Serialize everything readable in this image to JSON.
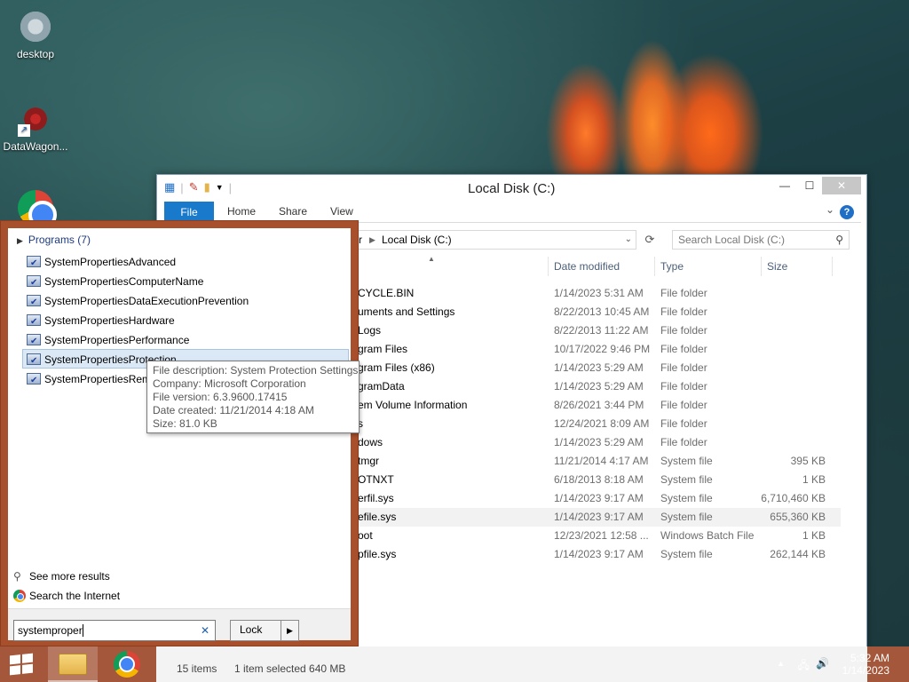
{
  "desktop": {
    "icons": [
      {
        "label": "desktop"
      },
      {
        "label": "DataWagon..."
      },
      {
        "label": ""
      }
    ]
  },
  "explorer": {
    "title": "Local Disk (C:)",
    "ribbon_tabs": [
      "File",
      "Home",
      "Share",
      "View"
    ],
    "address": {
      "prefix": "r",
      "crumb": "Local Disk (C:)"
    },
    "search_placeholder": "Search Local Disk (C:)",
    "columns": {
      "date": "Date modified",
      "type": "Type",
      "size": "Size"
    },
    "rows": [
      {
        "name": "CYCLE.BIN",
        "date": "1/14/2023 5:31 AM",
        "type": "File folder",
        "size": ""
      },
      {
        "name": "uments and Settings",
        "date": "8/22/2013 10:45 AM",
        "type": "File folder",
        "size": ""
      },
      {
        "name": "Logs",
        "date": "8/22/2013 11:22 AM",
        "type": "File folder",
        "size": ""
      },
      {
        "name": "gram Files",
        "date": "10/17/2022 9:46 PM",
        "type": "File folder",
        "size": ""
      },
      {
        "name": "gram Files (x86)",
        "date": "1/14/2023 5:29 AM",
        "type": "File folder",
        "size": ""
      },
      {
        "name": "gramData",
        "date": "1/14/2023 5:29 AM",
        "type": "File folder",
        "size": ""
      },
      {
        "name": "em Volume Information",
        "date": "8/26/2021 3:44 PM",
        "type": "File folder",
        "size": ""
      },
      {
        "name": "s",
        "date": "12/24/2021 8:09 AM",
        "type": "File folder",
        "size": ""
      },
      {
        "name": "dows",
        "date": "1/14/2023 5:29 AM",
        "type": "File folder",
        "size": ""
      },
      {
        "name": "tmgr",
        "date": "11/21/2014 4:17 AM",
        "type": "System file",
        "size": "395 KB"
      },
      {
        "name": "OTNXT",
        "date": "6/18/2013 8:18 AM",
        "type": "System file",
        "size": "1 KB"
      },
      {
        "name": "erfil.sys",
        "date": "1/14/2023 9:17 AM",
        "type": "System file",
        "size": "6,710,460 KB"
      },
      {
        "name": "efile.sys",
        "date": "1/14/2023 9:17 AM",
        "type": "System file",
        "size": "655,360 KB"
      },
      {
        "name": "oot",
        "date": "12/23/2021 12:58 ...",
        "type": "Windows Batch File",
        "size": "1 KB"
      },
      {
        "name": "pfile.sys",
        "date": "1/14/2023 9:17 AM",
        "type": "System file",
        "size": "262,144 KB"
      }
    ],
    "status": {
      "items": "15 items",
      "selected": "1 item selected  640 MB"
    }
  },
  "start": {
    "programs_header": "Programs (7)",
    "programs": [
      "SystemPropertiesAdvanced",
      "SystemPropertiesComputerName",
      "SystemPropertiesDataExecutionPrevention",
      "SystemPropertiesHardware",
      "SystemPropertiesPerformance",
      "SystemPropertiesProtection",
      "SystemPropertiesRem"
    ],
    "see_more": "See more results",
    "search_internet": "Search the Internet",
    "search_value": "systemproper",
    "lock_label": "Lock",
    "tooltip": [
      "File description: System Protection Settings",
      "Company: Microsoft Corporation",
      "File version: 6.3.9600.17415",
      "Date created: 11/21/2014 4:18 AM",
      "Size: 81.0 KB"
    ]
  },
  "taskbar": {
    "time": "5:32 AM",
    "date": "1/14/2023"
  }
}
